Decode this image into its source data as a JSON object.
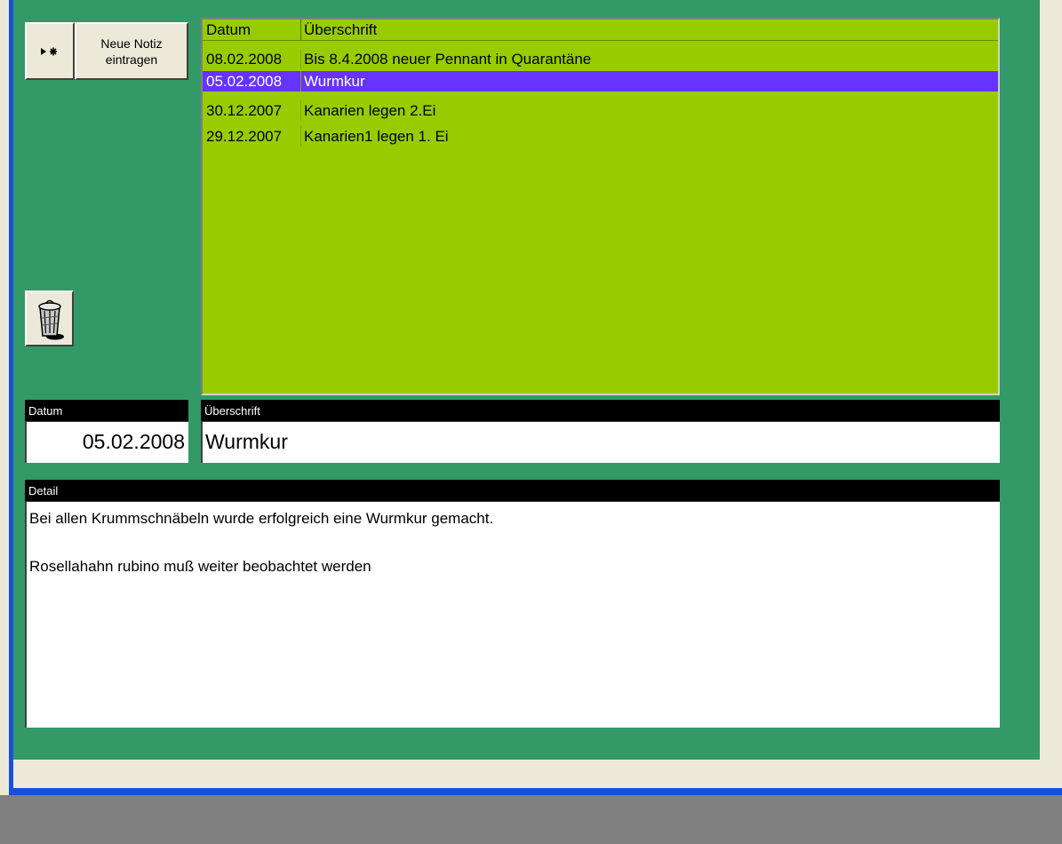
{
  "toolbar": {
    "new_note_label_line1": "Neue Notiz",
    "new_note_label_line2": "eintragen"
  },
  "notes_list": {
    "columns": [
      "Datum",
      "Überschrift"
    ],
    "rows": [
      {
        "date": "08.02.2008",
        "title": "Bis 8.4.2008 neuer Pennant in Quarantäne",
        "selected": false
      },
      {
        "date": "05.02.2008",
        "title": "Wurmkur",
        "selected": true
      },
      {
        "date": "30.12.2007",
        "title": "Kanarien legen 2.Ei",
        "selected": false
      },
      {
        "date": "29.12.2007",
        "title": "Kanarien1 legen 1. Ei",
        "selected": false
      }
    ]
  },
  "form": {
    "datum_label": "Datum",
    "datum_value": "05.02.2008",
    "ueberschrift_label": "Überschrift",
    "ueberschrift_value": "Wurmkur",
    "detail_label": "Detail",
    "detail_value": "Bei allen Krummschnäbeln wurde erfolgreich eine Wurmkur gemacht.\n\nRosellahahn rubino muß weiter beobachtet werden"
  },
  "icons": {
    "record_selector": "new-record-icon",
    "delete": "trash-can-icon"
  },
  "colors": {
    "form_background": "#339966",
    "list_background": "#99cc00",
    "selection": "#6633ff",
    "label_bar": "#000000",
    "window_border": "#1c4fd8"
  }
}
